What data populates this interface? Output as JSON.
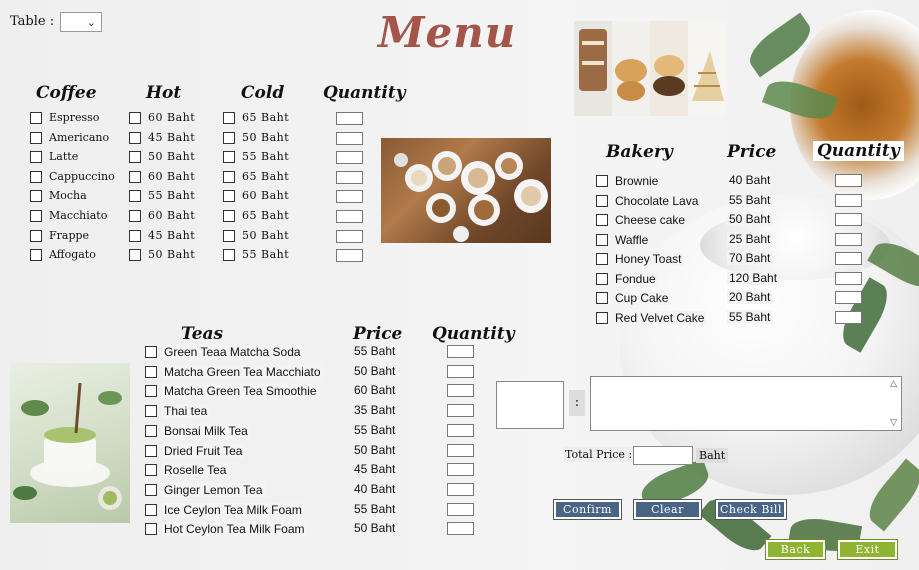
{
  "header": {
    "title": "Menu",
    "table_label": "Table :",
    "table_value": ""
  },
  "coffee": {
    "headers": {
      "name": "Coffee",
      "hot": "Hot",
      "cold": "Cold",
      "quantity": "Quantity"
    },
    "items": [
      {
        "name": "Espresso",
        "hot": "60 Baht",
        "cold": "65 Baht"
      },
      {
        "name": "Americano",
        "hot": "45 Baht",
        "cold": "50 Baht"
      },
      {
        "name": "Latte",
        "hot": "50 Baht",
        "cold": "55 Baht"
      },
      {
        "name": "Cappuccino",
        "hot": "60 Baht",
        "cold": "65 Baht"
      },
      {
        "name": "Mocha",
        "hot": "55 Baht",
        "cold": "60 Baht"
      },
      {
        "name": "Macchiato",
        "hot": "60 Baht",
        "cold": "65 Baht"
      },
      {
        "name": "Frappe",
        "hot": "45 Baht",
        "cold": "50 Baht"
      },
      {
        "name": "Affogato",
        "hot": "50 Baht",
        "cold": "55 Baht"
      }
    ]
  },
  "bakery": {
    "headers": {
      "name": "Bakery",
      "price": "Price",
      "quantity": "Quantity"
    },
    "items": [
      {
        "name": "Brownie",
        "price": "40 Baht"
      },
      {
        "name": "Chocolate Lava",
        "price": "55 Baht"
      },
      {
        "name": "Cheese cake",
        "price": "50 Baht"
      },
      {
        "name": "Waffle",
        "price": "25 Baht"
      },
      {
        "name": "Honey Toast",
        "price": "70 Baht"
      },
      {
        "name": "Fondue",
        "price": "120 Baht"
      },
      {
        "name": "Cup Cake",
        "price": "20 Baht"
      },
      {
        "name": "Red Velvet Cake",
        "price": "55 Baht"
      }
    ]
  },
  "teas": {
    "headers": {
      "name": "Teas",
      "price": "Price",
      "quantity": "Quantity"
    },
    "items": [
      {
        "name": "Green Teaa Matcha Soda",
        "price": "55 Baht"
      },
      {
        "name": "Matcha Green Tea Macchiato",
        "price": "50 Baht"
      },
      {
        "name": "Matcha Green Tea Smoothie",
        "price": "60 Baht"
      },
      {
        "name": "Thai tea",
        "price": "35 Baht"
      },
      {
        "name": "Bonsai Milk Tea",
        "price": "55 Baht"
      },
      {
        "name": "Dried Fruit Tea",
        "price": "50 Baht"
      },
      {
        "name": "Roselle Tea",
        "price": "45 Baht"
      },
      {
        "name": "Ginger Lemon Tea",
        "price": "40 Baht"
      },
      {
        "name": "Ice Ceylon Tea Milk Foam",
        "price": "55 Baht"
      },
      {
        "name": "Hot Ceylon Tea Milk Foam",
        "price": "50 Baht"
      }
    ]
  },
  "bill": {
    "separator": ":",
    "total_label": "Total Price :",
    "total_value": "",
    "currency": "Baht"
  },
  "buttons": {
    "confirm": "Confirm",
    "clear": "Clear",
    "check_bill": "Check Bill",
    "back": "Back",
    "exit": "Exit"
  },
  "icons": {
    "dropdown": "chevron-down-icon",
    "scroll_up": "scroll-up-icon",
    "scroll_down": "scroll-down-icon"
  },
  "colors": {
    "title": "#a4554a",
    "button_blue": "#4a6485",
    "button_green": "#8fb431"
  }
}
